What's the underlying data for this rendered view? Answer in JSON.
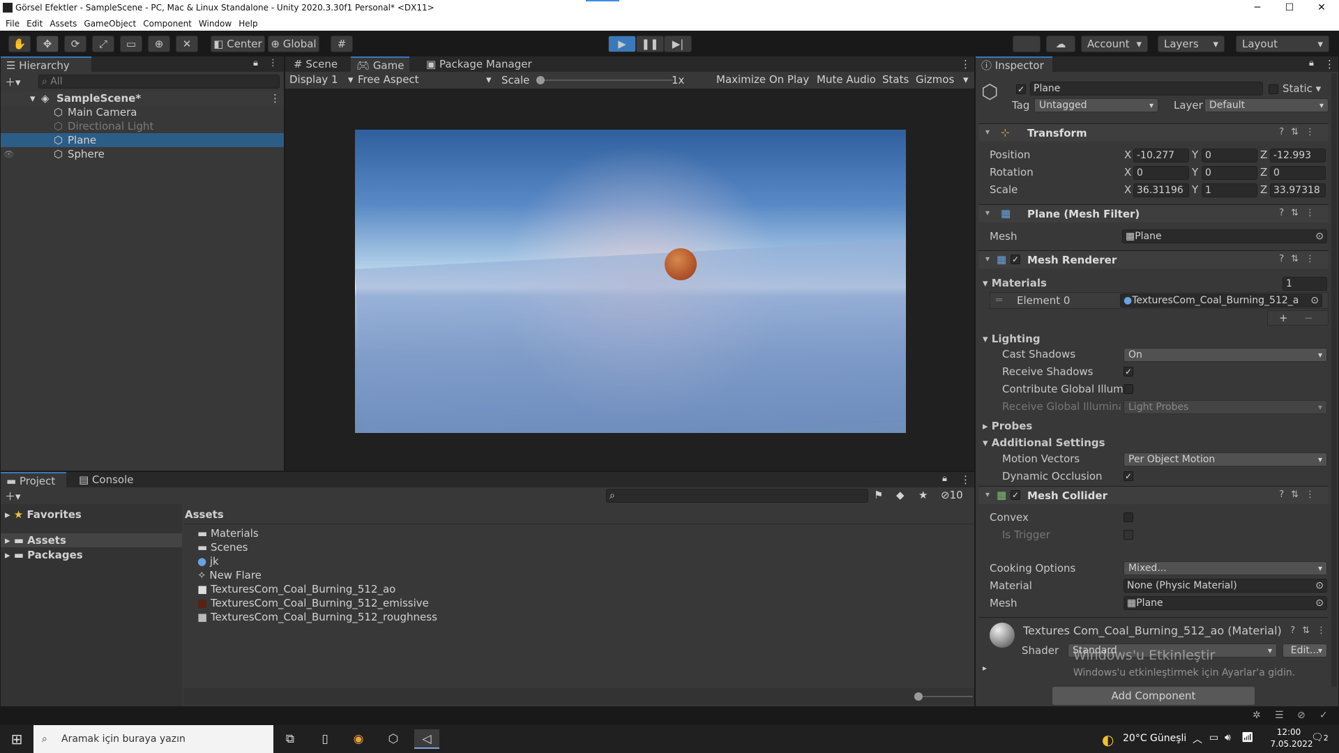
{
  "window": {
    "title": "Görsel Efektler - SampleScene - PC, Mac & Linux Standalone - Unity 2020.3.30f1 Personal* <DX11>",
    "min": "─",
    "max": "☐",
    "close": "✕"
  },
  "menu": [
    "File",
    "Edit",
    "Assets",
    "GameObject",
    "Component",
    "Window",
    "Help"
  ],
  "toolbar": {
    "center": "Center",
    "global": "Global",
    "account": "Account",
    "layers": "Layers",
    "layout": "Layout"
  },
  "hierarchy": {
    "tab": "Hierarchy",
    "search_placeholder": "All",
    "scene": "SampleScene*",
    "items": [
      "Main Camera",
      "Directional Light",
      "Plane",
      "Sphere"
    ]
  },
  "game": {
    "tabs": [
      "Scene",
      "Game",
      "Package Manager"
    ],
    "display": "Display 1",
    "aspect": "Free Aspect",
    "scale_label": "Scale",
    "scale_value": "1x",
    "maximize": "Maximize On Play",
    "mute": "Mute Audio",
    "stats": "Stats",
    "gizmos": "Gizmos"
  },
  "project": {
    "tabs": [
      "Project",
      "Console"
    ],
    "count": "10",
    "tree": {
      "favorites": "Favorites",
      "assets": "Assets",
      "packages": "Packages"
    },
    "breadcrumb": "Assets",
    "files": [
      "Materials",
      "Scenes",
      "jk",
      "New Flare",
      "TexturesCom_Coal_Burning_512_ao",
      "TexturesCom_Coal_Burning_512_emissive",
      "TexturesCom_Coal_Burning_512_roughness"
    ]
  },
  "inspector": {
    "tab": "Inspector",
    "name": "Plane",
    "static": "Static",
    "tag_label": "Tag",
    "tag": "Untagged",
    "layer_label": "Layer",
    "layer": "Default",
    "transform": {
      "title": "Transform",
      "position_label": "Position",
      "rotation_label": "Rotation",
      "scale_label": "Scale",
      "position": {
        "x": "-10.277",
        "y": "0",
        "z": "-12.993"
      },
      "rotation": {
        "x": "0",
        "y": "0",
        "z": "0"
      },
      "scale": {
        "x": "36.31196",
        "y": "1",
        "z": "33.97318"
      }
    },
    "mesh_filter": {
      "title": "Plane (Mesh Filter)",
      "mesh_label": "Mesh",
      "mesh": "Plane"
    },
    "mesh_renderer": {
      "title": "Mesh Renderer",
      "materials": "Materials",
      "materials_count": "1",
      "element0_label": "Element 0",
      "element0": "TexturesCom_Coal_Burning_512_a",
      "lighting": "Lighting",
      "cast_shadows_label": "Cast Shadows",
      "cast_shadows": "On",
      "receive_shadows": "Receive Shadows",
      "contribute_gi": "Contribute Global Illum",
      "receive_gi_label": "Receive Global Illumina",
      "receive_gi": "Light Probes",
      "probes": "Probes",
      "additional": "Additional Settings",
      "motion_vectors_label": "Motion Vectors",
      "motion_vectors": "Per Object Motion",
      "dynamic_occlusion": "Dynamic Occlusion"
    },
    "mesh_collider": {
      "title": "Mesh Collider",
      "convex": "Convex",
      "is_trigger": "Is Trigger",
      "cooking_label": "Cooking Options",
      "cooking": "Mixed...",
      "material_label": "Material",
      "material": "None (Physic Material)",
      "mesh_label": "Mesh",
      "mesh": "Plane"
    },
    "material": {
      "title": "Textures Com_Coal_Burning_512_ao (Material)",
      "shader_label": "Shader",
      "shader": "Standard",
      "edit": "Edit..."
    },
    "add_component": "Add Component",
    "watermark1": "Windows'u Etkinleştir",
    "watermark2": "Windows'u etkinleştirmek için Ayarlar'a gidin."
  },
  "taskbar": {
    "search": "Aramak için buraya yazın",
    "weather": "20°C  Güneşli",
    "time": "12:00",
    "date": "7.05.2022",
    "notif": "2"
  }
}
